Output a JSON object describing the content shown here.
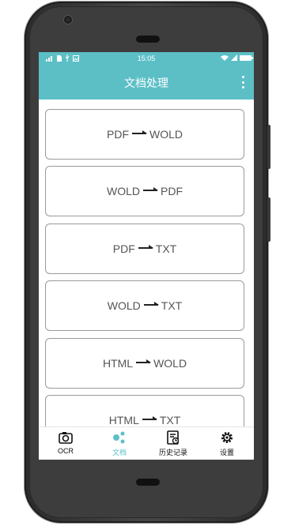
{
  "status_bar": {
    "time": "15:05"
  },
  "app_bar": {
    "title": "文档处理",
    "menu_icon": "more-vert-icon"
  },
  "conversions": [
    {
      "from": "PDF",
      "to": "WOLD"
    },
    {
      "from": "WOLD",
      "to": "PDF"
    },
    {
      "from": "PDF",
      "to": "TXT"
    },
    {
      "from": "WOLD",
      "to": "TXT"
    },
    {
      "from": "HTML",
      "to": "WOLD"
    },
    {
      "from": "HTML",
      "to": "TXT"
    }
  ],
  "bottom_nav": {
    "items": [
      {
        "label": "OCR",
        "icon": "camera-icon",
        "active": false
      },
      {
        "label": "文档",
        "icon": "share-icon",
        "active": true
      },
      {
        "label": "历史记录",
        "icon": "history-document-icon",
        "active": false
      },
      {
        "label": "设置",
        "icon": "gear-icon",
        "active": false
      }
    ]
  },
  "colors": {
    "accent": "#5cbfc6",
    "card_border": "#9a9a9a",
    "card_text": "#555555"
  }
}
